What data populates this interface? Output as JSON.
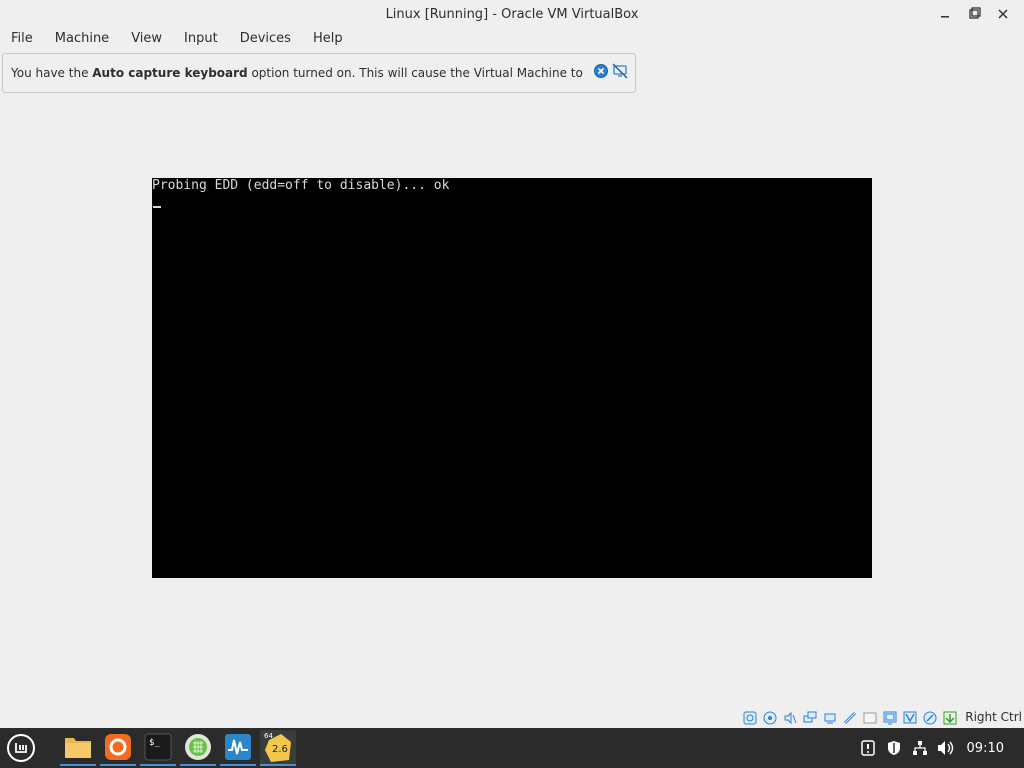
{
  "window": {
    "title": "Linux [Running] - Oracle VM VirtualBox",
    "controls": [
      "minimize-icon",
      "maximize-icon",
      "close-icon"
    ]
  },
  "menu": {
    "items": [
      "File",
      "Machine",
      "View",
      "Input",
      "Devices",
      "Help"
    ]
  },
  "notice": {
    "prefix": "You have the ",
    "bold": "Auto capture keyboard",
    "suffix": " option turned on. This will cause the Virtual Machine to",
    "icons": [
      "close-notice-icon",
      "do-not-show-again-icon"
    ]
  },
  "console": {
    "line1": "Probing EDD (edd=off to disable)... ok"
  },
  "statusbar": {
    "icons": [
      "hard-disk-icon",
      "optical-drive-icon",
      "audio-icon",
      "network-icon",
      "usb-icon",
      "shared-folders-icon",
      "display-icon",
      "video-capture-icon",
      "virtualization-icon",
      "mouse-integration-icon",
      "keyboard-icon"
    ],
    "host_key": "Right Ctrl"
  },
  "taskbar": {
    "apps": [
      "menu-icon",
      "files-icon",
      "firefox-icon",
      "terminal-icon",
      "calculator-icon",
      "system-monitor-icon",
      "virtualbox-icon"
    ],
    "vbox_badge": "2.6",
    "vbox_badge_top": "64",
    "tray": [
      "update-icon",
      "shield-icon",
      "network-icon",
      "volume-icon"
    ],
    "clock": "09:10"
  },
  "colors": {
    "window_bg": "#efefef",
    "vm_bg": "#000000",
    "taskbar_bg": "#2b2b2b",
    "accent": "#4a90d9"
  }
}
